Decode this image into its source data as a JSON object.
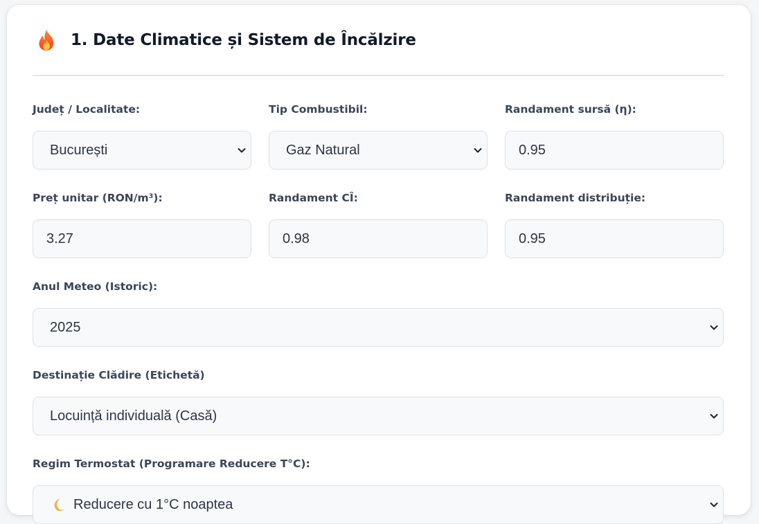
{
  "section": {
    "title": "1. Date Climatice și Sistem de Încălzire",
    "icon": "flame-icon"
  },
  "fields": {
    "judet": {
      "label": "Județ / Localitate:",
      "value": "București"
    },
    "combustibil": {
      "label": "Tip Combustibil:",
      "value": "Gaz Natural"
    },
    "randament_sursa": {
      "label": "Randament sursă (η):",
      "value": "0.95"
    },
    "pret_unitar": {
      "label": "Preț unitar (RON/m³):",
      "value": "3.27"
    },
    "randament_ci": {
      "label": "Randament CÎ:",
      "value": "0.98"
    },
    "randament_distributie": {
      "label": "Randament distribuție:",
      "value": "0.95"
    },
    "anul_meteo": {
      "label": "Anul Meteo (Istoric):",
      "value": "2025"
    },
    "destinatie": {
      "label": "Destinație Clădire (Etichetă)",
      "value": "Locuință individuală (Casă)"
    },
    "termostat": {
      "label": "Regim Termostat (Programare Reducere T°C):",
      "value": "Reducere cu 1°C noaptea",
      "icon": "crescent-moon-icon"
    }
  },
  "colors": {
    "title": "#121a2a",
    "label": "#3a4657",
    "control_bg": "#f7f9fb",
    "control_border": "#dde1e6",
    "flame": "#f4511e"
  }
}
